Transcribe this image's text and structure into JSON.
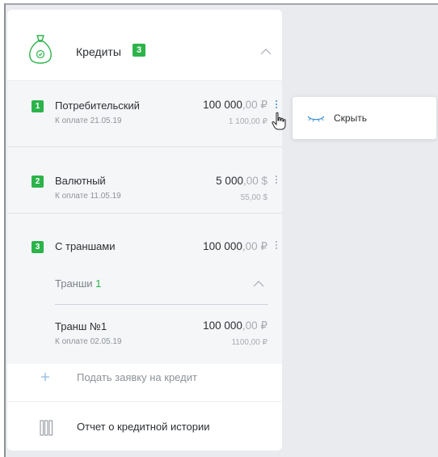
{
  "panel": {
    "title": "Кредиты",
    "count": "3"
  },
  "loans": [
    {
      "index": "1",
      "name": "Потребительский",
      "amount_int": "100 000",
      "amount_frac": ",00 ₽",
      "due": "К оплате 21.05.19",
      "payment": "1 100,00 ₽"
    },
    {
      "index": "2",
      "name": "Валютный",
      "amount_int": "5 000",
      "amount_frac": ",00 $",
      "due": "К оплате 11.05.19",
      "payment": "55,00 $"
    },
    {
      "index": "3",
      "name": "С траншами",
      "amount_int": "100 000",
      "amount_frac": ",00 ₽"
    }
  ],
  "tranches": {
    "label": "Транши",
    "count": "1",
    "items": [
      {
        "name": "Транш №1",
        "amount_int": "100 000",
        "amount_frac": ",00 ₽",
        "due": "К оплате 02.05.19",
        "payment": "1100,00 ₽"
      }
    ]
  },
  "actions": {
    "apply": "Подать заявку на кредит",
    "report": "Отчет о кредитной истории"
  },
  "context_menu": {
    "hide": "Скрыть"
  },
  "colors": {
    "accent_green": "#2cb34a",
    "accent_blue": "#3b8fd6"
  },
  "icons": {
    "header": "money-bag-icon",
    "hide": "closed-eye-icon",
    "add": "plus-icon",
    "report": "document-stack-icon"
  }
}
